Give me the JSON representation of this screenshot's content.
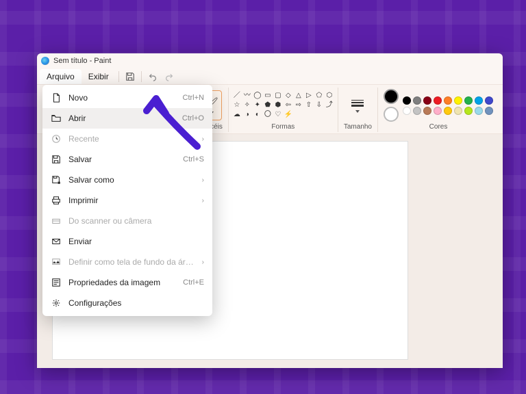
{
  "title": "Sem título - Paint",
  "menubar": {
    "file": "Arquivo",
    "view": "Exibir"
  },
  "ribbon": {
    "brushes_label": "Pincéis",
    "shapes_label": "Formas",
    "size_label": "Tamanho",
    "colors_label": "Cores"
  },
  "palette_row1": [
    "#000000",
    "#7f7f7f",
    "#880015",
    "#ed1c24",
    "#ff7f27",
    "#fff200",
    "#22b14c",
    "#00a2e8",
    "#3f48cc"
  ],
  "palette_row2": [
    "#ffffff",
    "#c3c3c3",
    "#b97a57",
    "#ffaec9",
    "#ffc90e",
    "#efe4b0",
    "#b5e61d",
    "#99d9ea",
    "#7092be"
  ],
  "file_menu": [
    {
      "icon": "file-icon",
      "label": "Novo",
      "accel": "Ctrl+N",
      "enabled": true,
      "sub": false
    },
    {
      "icon": "folder-open-icon",
      "label": "Abrir",
      "accel": "Ctrl+O",
      "enabled": true,
      "sub": false,
      "hover": true
    },
    {
      "icon": "clock-icon",
      "label": "Recente",
      "accel": "",
      "enabled": false,
      "sub": true
    },
    {
      "icon": "save-icon",
      "label": "Salvar",
      "accel": "Ctrl+S",
      "enabled": true,
      "sub": false
    },
    {
      "icon": "save-as-icon",
      "label": "Salvar como",
      "accel": "",
      "enabled": true,
      "sub": true
    },
    {
      "icon": "print-icon",
      "label": "Imprimir",
      "accel": "",
      "enabled": true,
      "sub": true
    },
    {
      "icon": "scanner-icon",
      "label": "Do scanner ou câmera",
      "accel": "",
      "enabled": false,
      "sub": false
    },
    {
      "icon": "send-icon",
      "label": "Enviar",
      "accel": "",
      "enabled": true,
      "sub": false
    },
    {
      "icon": "wallpaper-icon",
      "label": "Definir como tela de fundo da área de trabalho",
      "accel": "",
      "enabled": false,
      "sub": true
    },
    {
      "icon": "properties-icon",
      "label": "Propriedades da imagem",
      "accel": "Ctrl+E",
      "enabled": true,
      "sub": false
    },
    {
      "icon": "gear-icon",
      "label": "Configurações",
      "accel": "",
      "enabled": true,
      "sub": false
    }
  ],
  "annotation_arrow_color": "#4a1fd1"
}
